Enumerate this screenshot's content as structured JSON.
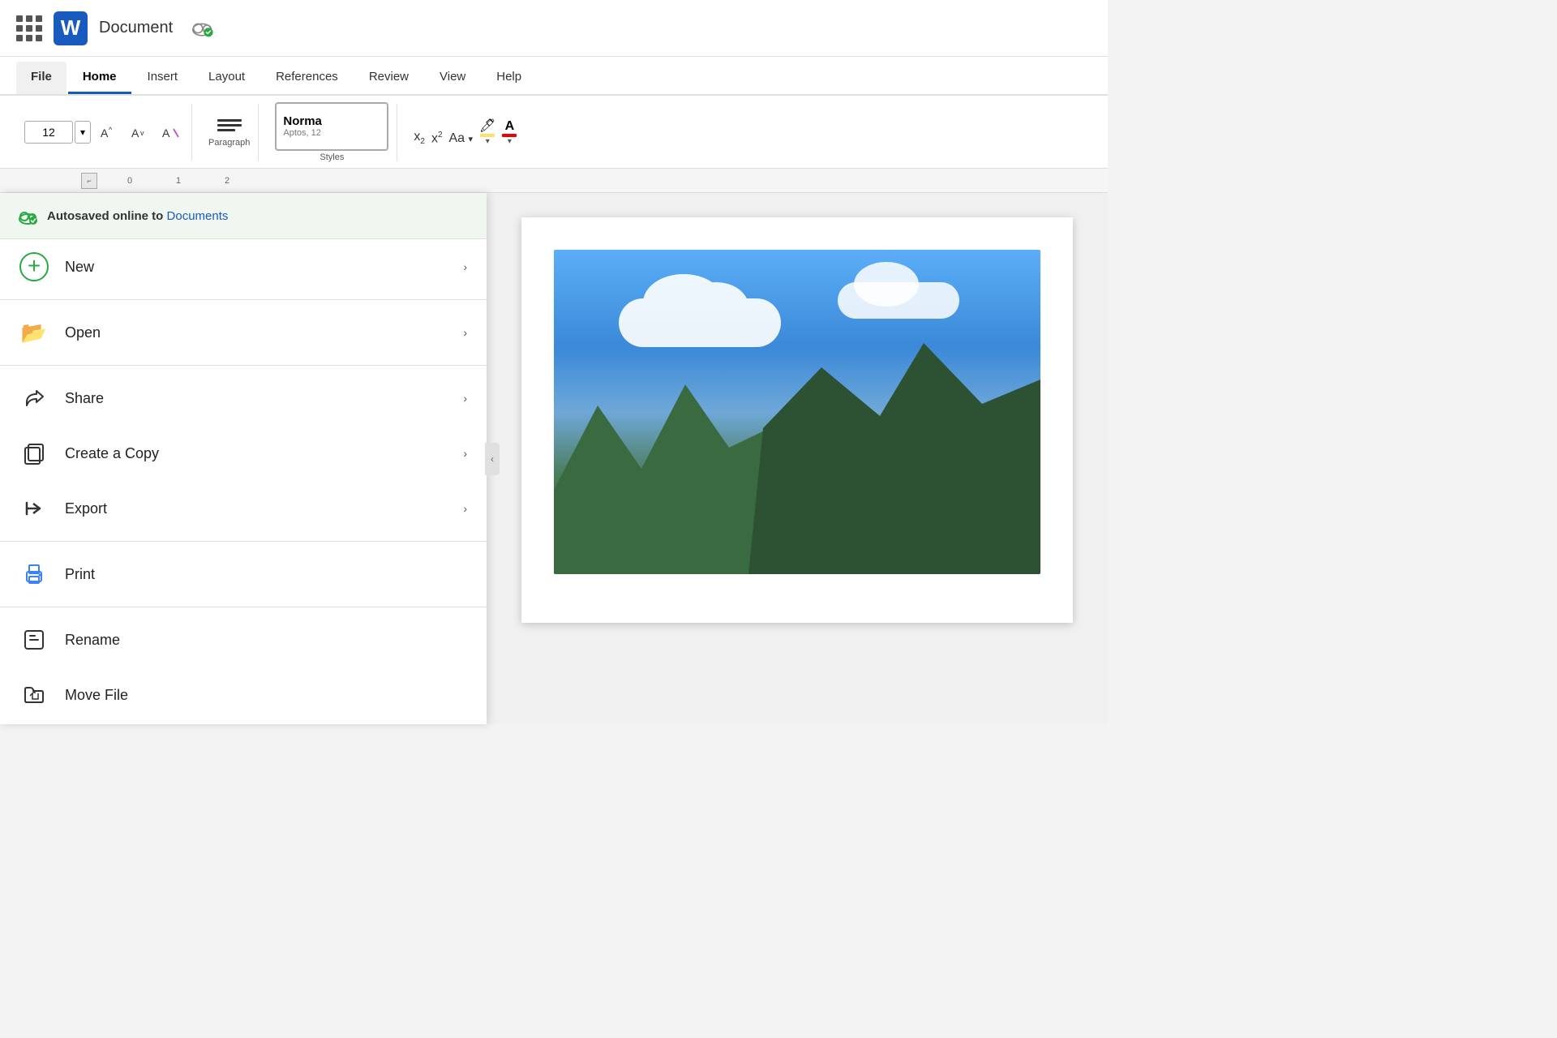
{
  "titlebar": {
    "doc_title": "Document",
    "word_letter": "W",
    "cloud_status": "synced"
  },
  "ribbon": {
    "tabs": [
      {
        "id": "file",
        "label": "File",
        "active": false,
        "class": "file"
      },
      {
        "id": "home",
        "label": "Home",
        "active": true,
        "class": "active"
      },
      {
        "id": "insert",
        "label": "Insert",
        "active": false,
        "class": ""
      },
      {
        "id": "layout",
        "label": "Layout",
        "active": false,
        "class": ""
      },
      {
        "id": "references",
        "label": "References",
        "active": false,
        "class": ""
      },
      {
        "id": "review",
        "label": "Review",
        "active": false,
        "class": ""
      },
      {
        "id": "view",
        "label": "View",
        "active": false,
        "class": ""
      },
      {
        "id": "help",
        "label": "Help",
        "active": false,
        "class": ""
      }
    ],
    "font_size": "12",
    "paragraph_label": "Paragraph",
    "styles_name": "Norma",
    "styles_sub": "Aptos, 12"
  },
  "file_menu": {
    "autosave_text": "Autosaved online to",
    "autosave_link": "Documents",
    "menu_items": [
      {
        "id": "new",
        "label": "New",
        "icon": "➕",
        "icon_color": "#2aa842",
        "has_arrow": true
      },
      {
        "id": "open",
        "label": "Open",
        "icon": "📂",
        "icon_color": "#f5a623",
        "has_arrow": true
      },
      {
        "id": "share",
        "label": "Share",
        "icon": "↗",
        "icon_color": "#555",
        "has_arrow": true
      },
      {
        "id": "create-copy",
        "label": "Create a Copy",
        "icon": "⧉",
        "icon_color": "#555",
        "has_arrow": true
      },
      {
        "id": "export",
        "label": "Export",
        "icon": "↪",
        "icon_color": "#555",
        "has_arrow": true
      },
      {
        "id": "print",
        "label": "Print",
        "icon": "🖨",
        "icon_color": "#3b82f6",
        "has_arrow": false
      },
      {
        "id": "rename",
        "label": "Rename",
        "icon": "⊡",
        "icon_color": "#555",
        "has_arrow": false
      },
      {
        "id": "move-file",
        "label": "Move File",
        "icon": "📁",
        "icon_color": "#555",
        "has_arrow": false
      }
    ]
  },
  "ruler": {
    "marks": [
      "0",
      "1",
      "2"
    ],
    "tab_symbol": "⌐"
  }
}
